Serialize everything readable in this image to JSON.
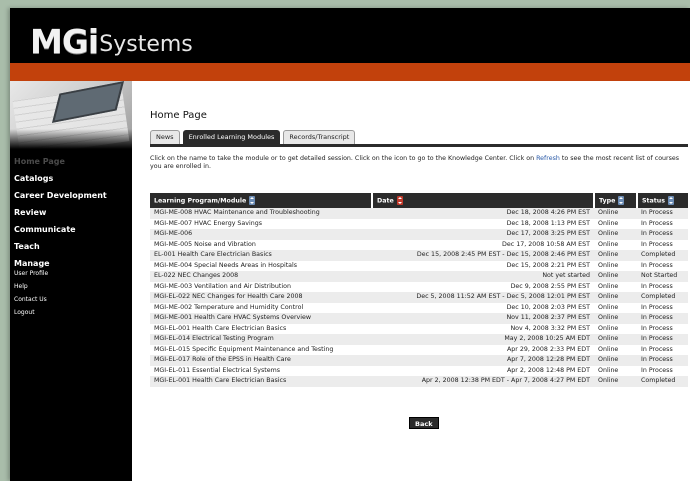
{
  "brand": {
    "logo_main": "MGi",
    "logo_suffix": "Systems"
  },
  "colors": {
    "accent_bar": "#c2410c",
    "header_bg": "#000000",
    "table_header": "#2b2b2b",
    "link": "#2a5aa8"
  },
  "sidebar": {
    "main_items": [
      {
        "label": "Home Page",
        "active": true
      },
      {
        "label": "Catalogs"
      },
      {
        "label": "Career Development"
      },
      {
        "label": "Review"
      },
      {
        "label": "Communicate"
      },
      {
        "label": "Teach"
      },
      {
        "label": "Manage"
      }
    ],
    "sub_items": [
      {
        "label": "User Profile"
      },
      {
        "label": "Help"
      },
      {
        "label": "Contact Us"
      },
      {
        "label": "Logout"
      }
    ]
  },
  "main": {
    "title": "Home Page",
    "tabs": [
      {
        "label": "News"
      },
      {
        "label": "Enrolled Learning Modules",
        "active": true
      },
      {
        "label": "Records/Transcript"
      }
    ],
    "instructions": {
      "before": "Click on the name to take the module or to get detailed session. Click on the icon to go to the Knowledge Center. Click on ",
      "link": "Refresh",
      "after": " to see the most recent list of courses you are enrolled in."
    },
    "table": {
      "headers": {
        "module": "Learning Program/Module",
        "date": "Date",
        "type": "Type",
        "status": "Status"
      },
      "rows": [
        {
          "module": "MGI-ME-008 HVAC Maintenance and Troubleshooting",
          "date": "Dec 18, 2008 4:26 PM EST",
          "type": "Online",
          "status": "In Process"
        },
        {
          "module": "MGI-ME-007 HVAC Energy Savings",
          "date": "Dec 18, 2008 1:13 PM EST",
          "type": "Online",
          "status": "In Process"
        },
        {
          "module": "MGI-ME-006",
          "date": "Dec 17, 2008 3:25 PM EST",
          "type": "Online",
          "status": "In Process"
        },
        {
          "module": "MGI-ME-005 Noise and Vibration",
          "date": "Dec 17, 2008 10:58 AM EST",
          "type": "Online",
          "status": "In Process"
        },
        {
          "module": "EL-001 Health Care Electrician Basics",
          "date": "Dec 15, 2008 2:45 PM EST - Dec 15, 2008 2:46 PM EST",
          "type": "Online",
          "status": "Completed"
        },
        {
          "module": "MGI-ME-004 Special Needs Areas in Hospitals",
          "date": "Dec 15, 2008 2:21 PM EST",
          "type": "Online",
          "status": "In Process"
        },
        {
          "module": "EL-022 NEC Changes 2008",
          "date": "Not yet started",
          "type": "Online",
          "status": "Not Started"
        },
        {
          "module": "MGI-ME-003 Ventilation and Air Distribution",
          "date": "Dec 9, 2008 2:55 PM EST",
          "type": "Online",
          "status": "In Process"
        },
        {
          "module": "MGI-EL-022 NEC Changes for Health Care 2008",
          "date": "Dec 5, 2008 11:52 AM EST - Dec 5, 2008 12:01 PM EST",
          "type": "Online",
          "status": "Completed"
        },
        {
          "module": "MGI-ME-002 Temperature and Humidity Control",
          "date": "Dec 10, 2008 2:03 PM EST",
          "type": "Online",
          "status": "In Process"
        },
        {
          "module": "MGI-ME-001 Health Care HVAC Systems Overview",
          "date": "Nov 11, 2008 2:37 PM EST",
          "type": "Online",
          "status": "In Process"
        },
        {
          "module": "MGI-EL-001 Health Care Electrician Basics",
          "date": "Nov 4, 2008 3:32 PM EST",
          "type": "Online",
          "status": "In Process"
        },
        {
          "module": "MGI-EL-014 Electrical Testing Program",
          "date": "May 2, 2008 10:25 AM EDT",
          "type": "Online",
          "status": "In Process"
        },
        {
          "module": "MGI-EL-015 Specific Equipment Maintenance and Testing",
          "date": "Apr 29, 2008 2:33 PM EDT",
          "type": "Online",
          "status": "In Process"
        },
        {
          "module": "MGI-EL-017 Role of the EPSS in Health Care",
          "date": "Apr 7, 2008 12:28 PM EDT",
          "type": "Online",
          "status": "In Process"
        },
        {
          "module": "MGI-EL-011 Essential Electrical Systems",
          "date": "Apr 2, 2008 12:48 PM EDT",
          "type": "Online",
          "status": "In Process"
        },
        {
          "module": "MGI-EL-001 Health Care Electrician Basics",
          "date": "Apr 2, 2008 12:38 PM EDT - Apr 7, 2008 4:27 PM EDT",
          "type": "Online",
          "status": "Completed"
        }
      ]
    },
    "back_label": "Back"
  }
}
